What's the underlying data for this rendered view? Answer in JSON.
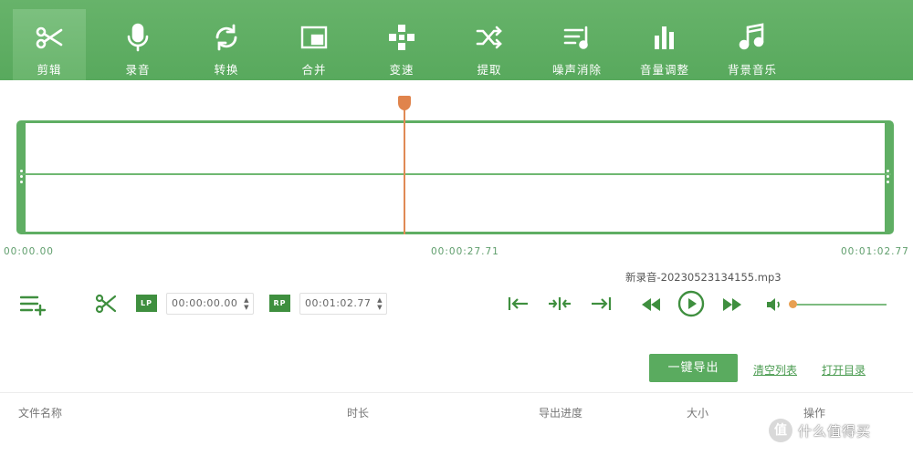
{
  "toolbar": {
    "items": [
      {
        "label": "剪辑",
        "icon": "scissors-icon",
        "active": true
      },
      {
        "label": "录音",
        "icon": "microphone-icon"
      },
      {
        "label": "转换",
        "icon": "convert-icon"
      },
      {
        "label": "合并",
        "icon": "merge-icon"
      },
      {
        "label": "变速",
        "icon": "speed-icon"
      },
      {
        "label": "提取",
        "icon": "shuffle-icon"
      },
      {
        "label": "噪声消除",
        "icon": "noise-removal-icon"
      },
      {
        "label": "音量调整",
        "icon": "volume-bars-icon"
      },
      {
        "label": "背景音乐",
        "icon": "music-note-icon"
      }
    ]
  },
  "timeline": {
    "start": "00:00.00",
    "cursor": "00:00:27.71",
    "end": "00:01:02.77",
    "playhead_fraction": 0.441
  },
  "file": {
    "name": "新录音-20230523134155.mp3"
  },
  "trim": {
    "lp_label": "LP",
    "lp_value": "00:00:00.00",
    "rp_label": "RP",
    "rp_value": "00:01:02.77"
  },
  "volume": {
    "level": 0.0
  },
  "actions": {
    "export": "一键导出",
    "clear_list": "清空列表",
    "open_dir": "打开目录"
  },
  "table": {
    "headers": [
      "文件名称",
      "时长",
      "导出进度",
      "大小",
      "操作"
    ]
  },
  "watermark": {
    "logo": "值",
    "text": "什么值得买"
  },
  "colors": {
    "toolbar_green": "#5faf63",
    "accent_green": "#5aab5f",
    "playhead_orange": "#e08a55"
  }
}
